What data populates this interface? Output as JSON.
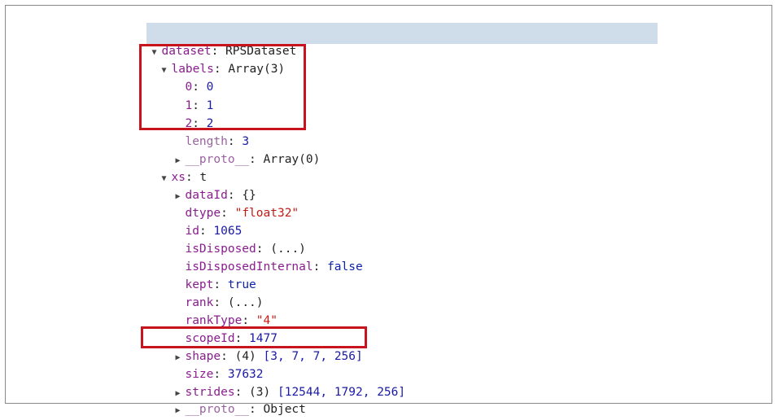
{
  "tree": {
    "dataset": {
      "arrow": "▼",
      "key": "dataset",
      "value": "RPSDataset"
    },
    "labels": {
      "arrow": "▼",
      "key": "labels",
      "value": "Array(3)"
    },
    "label_items": [
      {
        "key": "0",
        "value": "0"
      },
      {
        "key": "1",
        "value": "1"
      },
      {
        "key": "2",
        "value": "2"
      }
    ],
    "labels_length": {
      "key": "length",
      "value": "3"
    },
    "labels_proto": {
      "arrow": "▶",
      "key": "__proto__",
      "value": "Array(0)"
    },
    "xs": {
      "arrow": "▼",
      "key": "xs",
      "value": "t"
    },
    "dataId": {
      "arrow": "▶",
      "key": "dataId",
      "value": "{}"
    },
    "dtype": {
      "key": "dtype",
      "value": "\"float32\""
    },
    "id": {
      "key": "id",
      "value": "1065"
    },
    "isDisposed": {
      "key": "isDisposed",
      "value": "(...)"
    },
    "isDisposedInternal": {
      "key": "isDisposedInternal",
      "value": "false"
    },
    "kept": {
      "key": "kept",
      "value": "true"
    },
    "rank": {
      "key": "rank",
      "value": "(...)"
    },
    "rankType": {
      "key": "rankType",
      "value": "\"4\""
    },
    "scopeId": {
      "key": "scopeId",
      "value": "1477"
    },
    "shape": {
      "arrow": "▶",
      "key": "shape",
      "count": "(4)",
      "value": "[3, 7, 7, 256]"
    },
    "size": {
      "key": "size",
      "value": "37632"
    },
    "strides": {
      "arrow": "▶",
      "key": "strides",
      "count": "(3)",
      "value": "[12544, 1792, 256]"
    },
    "xs_proto": {
      "arrow": "▶",
      "key": "__proto__",
      "value": "Object"
    }
  },
  "colors": {
    "highlight": "#cfdce9",
    "redbox": "#c8141e",
    "key": "#8a1d8e",
    "number": "#1a1aa6",
    "string": "#c41a16"
  }
}
